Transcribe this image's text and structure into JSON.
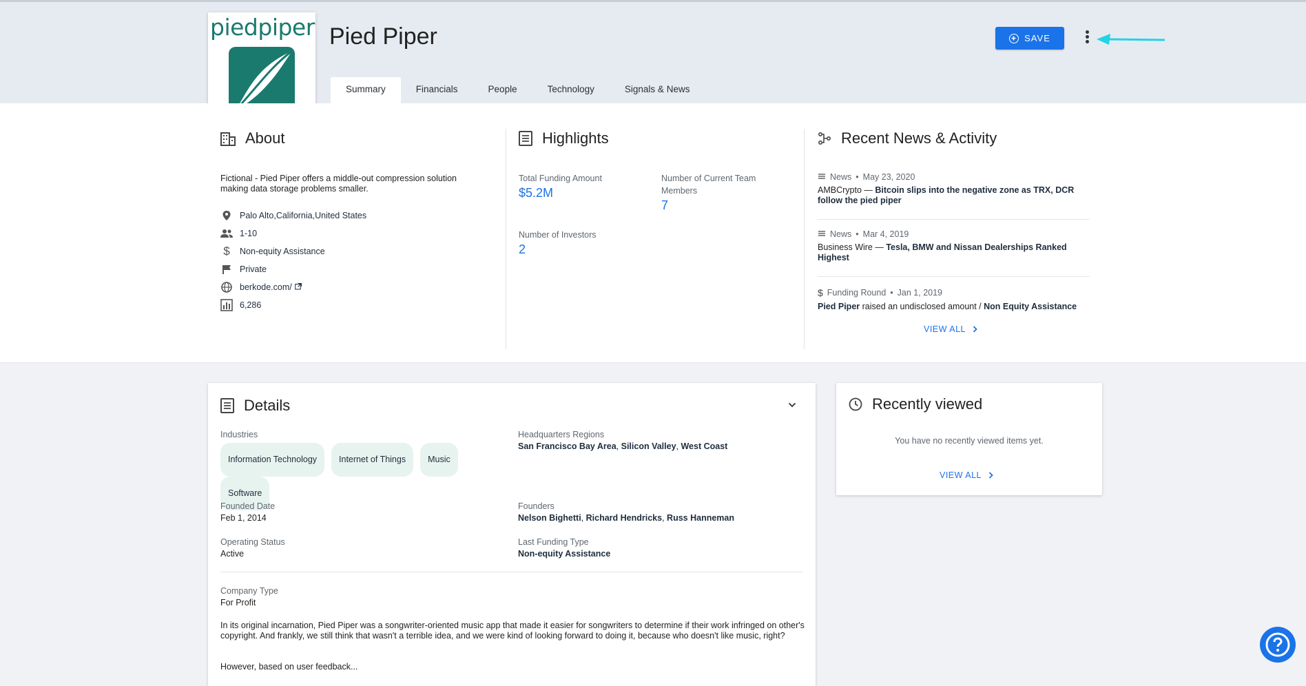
{
  "company": {
    "name": "Pied Piper",
    "logo_text": "piedpiper"
  },
  "header": {
    "save_label": "SAVE",
    "tabs": [
      "Summary",
      "Financials",
      "People",
      "Technology",
      "Signals & News"
    ]
  },
  "about": {
    "title": "About",
    "description": "Fictional - Pied Piper offers a middle-out compression solution making data storage problems smaller.",
    "location": "Palo Alto,California,United States",
    "employees": "1-10",
    "funding_type": "Non-equity Assistance",
    "ownership": "Private",
    "website": "berkode.com/",
    "rank": "6,286"
  },
  "highlights": {
    "title": "Highlights",
    "total_funding_label": "Total Funding Amount",
    "total_funding_value": "$5.2M",
    "team_label_1": "Number of Current Team",
    "team_label_2": "Members",
    "team_value": "7",
    "investors_label": "Number of Investors",
    "investors_value": "2"
  },
  "news": {
    "title": "Recent News & Activity",
    "items": [
      {
        "type": "News",
        "date": "May 23, 2020",
        "source": "AMBCrypto",
        "headline": "Bitcoin slips into the negative zone as TRX, DCR follow the pied piper"
      },
      {
        "type": "News",
        "date": "Mar 4, 2019",
        "source": "Business Wire",
        "headline": "Tesla, BMW and Nissan Dealerships Ranked Highest"
      },
      {
        "type": "Funding Round",
        "date": "Jan 1, 2019",
        "org": "Pied Piper",
        "mid": "raised an undisclosed amount /",
        "round": "Non Equity Assistance"
      }
    ],
    "view_all": "VIEW ALL"
  },
  "details": {
    "title": "Details",
    "industries_label": "Industries",
    "industries": [
      "Information Technology",
      "Internet of Things",
      "Music",
      "Software"
    ],
    "hq_label": "Headquarters Regions",
    "hq_regions": [
      "San Francisco Bay Area",
      "Silicon Valley",
      "West Coast"
    ],
    "founded_label": "Founded Date",
    "founded_value": "Feb 1, 2014",
    "founders_label": "Founders",
    "founders": [
      "Nelson Bighetti",
      "Richard Hendricks",
      "Russ Hanneman"
    ],
    "status_label": "Operating Status",
    "status_value": "Active",
    "last_funding_label": "Last Funding Type",
    "last_funding_value": "Non-equity Assistance",
    "company_type_label": "Company Type",
    "company_type_value": "For Profit",
    "description": "In its original incarnation, Pied Piper was a songwriter-oriented music app that made it easier for songwriters to determine if their work infringed on other's copyright. And frankly, we still think that wasn't a terrible idea, and we were kind of looking forward to doing it, because who doesn't like music, right?",
    "description_2": "However, based on user feedback..."
  },
  "recently_viewed": {
    "title": "Recently viewed",
    "empty_text": "You have no recently viewed items yet.",
    "view_all": "VIEW ALL"
  },
  "colors": {
    "accent": "#1a73e8",
    "logo_teal": "#1a7a6e",
    "arrow": "#22d3e6"
  }
}
